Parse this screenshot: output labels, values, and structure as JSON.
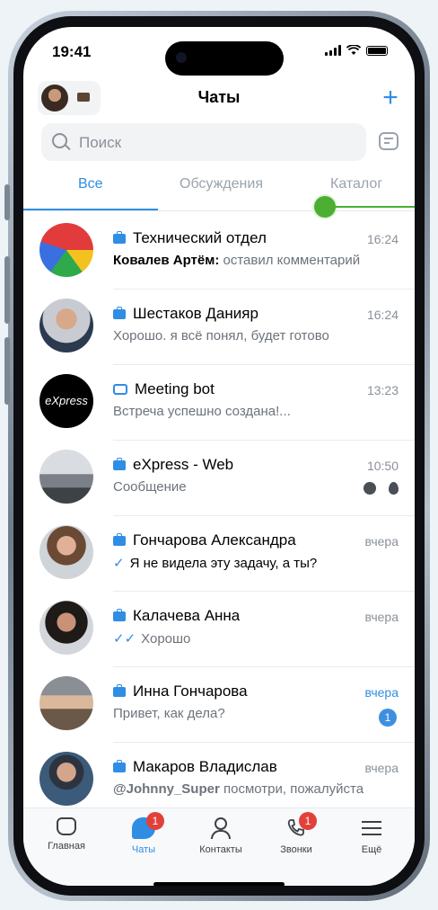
{
  "status": {
    "time": "19:41"
  },
  "header": {
    "title": "Чаты",
    "add_label": "+"
  },
  "search": {
    "placeholder": "Поиск"
  },
  "tabs": [
    {
      "label": "Все"
    },
    {
      "label": "Обсуждения"
    },
    {
      "label": "Каталог"
    }
  ],
  "chats": [
    {
      "name": "Технический отдел",
      "time": "16:24",
      "preview_author": "Ковалев Артём:",
      "preview": "оставил комментарий",
      "type": "group"
    },
    {
      "name": "Шестаков Данияр",
      "time": "16:24",
      "preview": "Хорошо. я всё понял, будет готово",
      "type": "work"
    },
    {
      "name": "Meeting bot",
      "time": "13:23",
      "preview": "Встреча успешно создана!...",
      "type": "bot",
      "avatar_text": "eXpress"
    },
    {
      "name": "eXpress - Web",
      "time": "10:50",
      "preview": "Сообщение",
      "type": "work"
    },
    {
      "name": "Гончарова Александра",
      "time": "вчера",
      "preview": "Я не видела эту задачу, а ты?",
      "check": "✓",
      "type": "work"
    },
    {
      "name": "Калачева Анна",
      "time": "вчера",
      "preview": "Хорошо",
      "check": "✓✓",
      "type": "work"
    },
    {
      "name": "Инна Гончарова",
      "time": "вчера",
      "preview": "Привет, как дела?",
      "badge": "1",
      "type": "work"
    },
    {
      "name": "Макаров Владислав",
      "time": "вчера",
      "preview_author": "@Johnny_Super",
      "preview": "посмотри, пожалуйста",
      "type": "work"
    }
  ],
  "tabbar": [
    {
      "label": "Главная"
    },
    {
      "label": "Чаты",
      "badge": "1"
    },
    {
      "label": "Контакты"
    },
    {
      "label": "Звонки",
      "badge": "1"
    },
    {
      "label": "Ещё"
    }
  ],
  "colors": {
    "accent": "#2f8de4",
    "badge_red": "#e2413a",
    "unread_badge": "#3e8fe0"
  }
}
